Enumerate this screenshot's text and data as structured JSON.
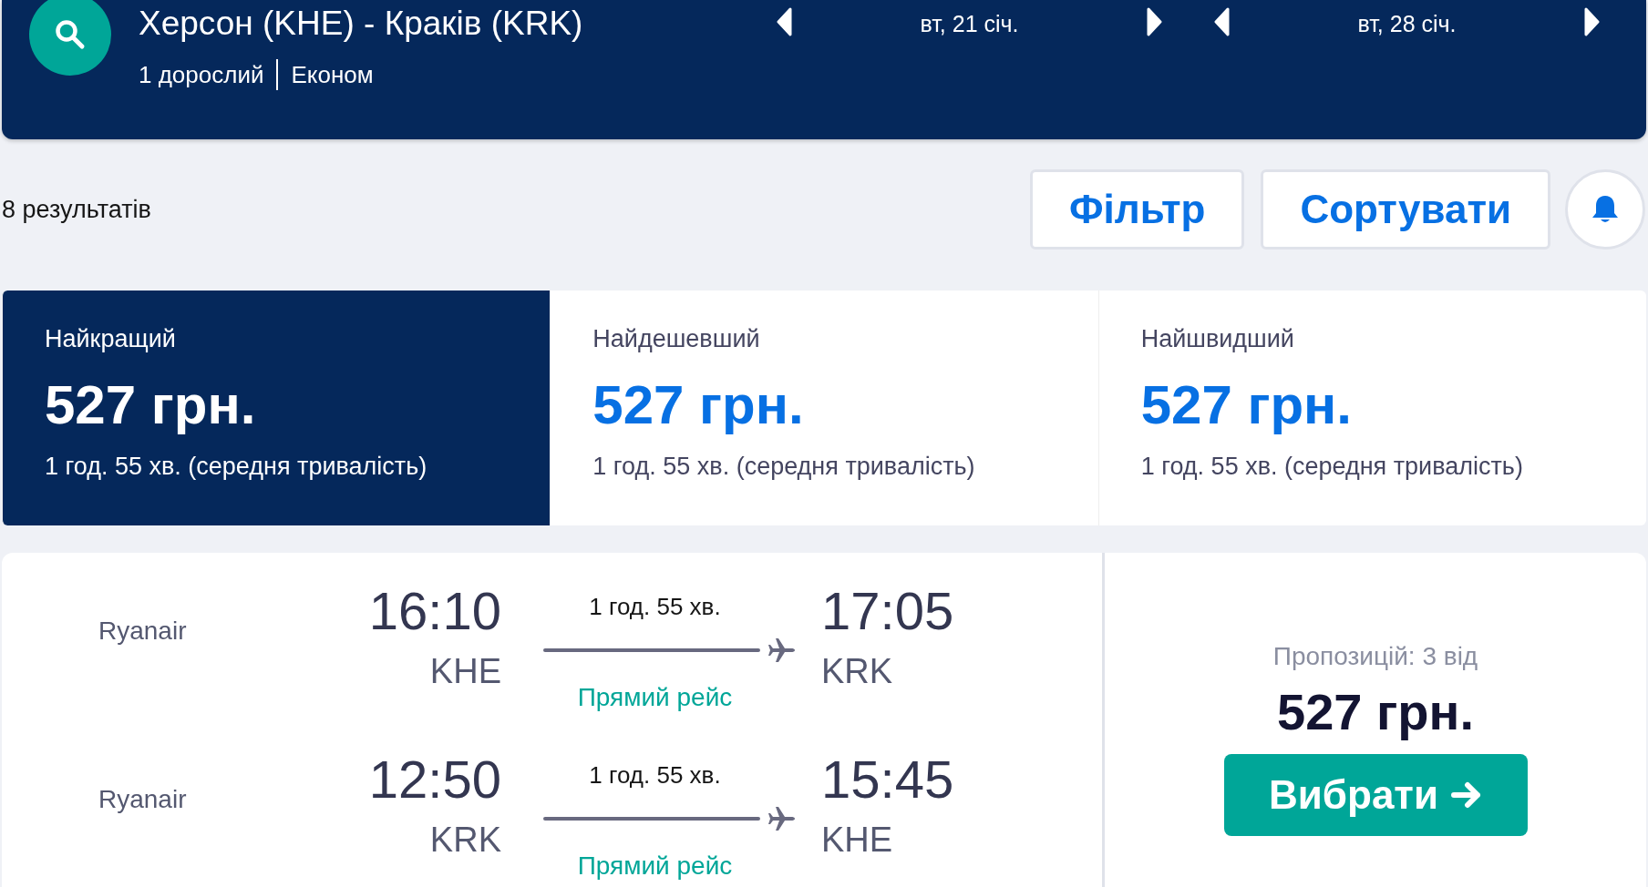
{
  "search": {
    "route": "Херсон (KHE) - Краків (KRK)",
    "passengers": "1 дорослий",
    "cabin": "Економ",
    "dates": [
      "вт, 21 січ.",
      "вт, 28 січ."
    ]
  },
  "toolbar": {
    "results": "8 результатів",
    "buttons": [
      "Фільтр",
      "Сортувати"
    ]
  },
  "tabs": [
    {
      "label": "Найкращий",
      "price": "527 грн.",
      "duration": "1 год. 55 хв. (середня тривалість)",
      "selected": true
    },
    {
      "label": "Найдешевший",
      "price": "527 грн.",
      "duration": "1 год. 55 хв. (середня тривалість)",
      "selected": false
    },
    {
      "label": "Найшвидший",
      "price": "527 грн.",
      "duration": "1 год. 55 хв. (середня тривалість)",
      "selected": false
    }
  ],
  "result": {
    "legs": [
      {
        "airline": "Ryanair",
        "depart_time": "16:10",
        "depart_airport": "KHE",
        "duration": "1 год. 55 хв.",
        "arrive_time": "17:05",
        "arrive_airport": "KRK",
        "stops": "Прямий рейс"
      },
      {
        "airline": "Ryanair",
        "depart_time": "12:50",
        "depart_airport": "KRK",
        "duration": "1 год. 55 хв.",
        "arrive_time": "15:45",
        "arrive_airport": "KHE",
        "stops": "Прямий рейс"
      }
    ],
    "offers": "Пропозицій: 3 від",
    "price": "527 грн.",
    "button": "Вибрати"
  }
}
